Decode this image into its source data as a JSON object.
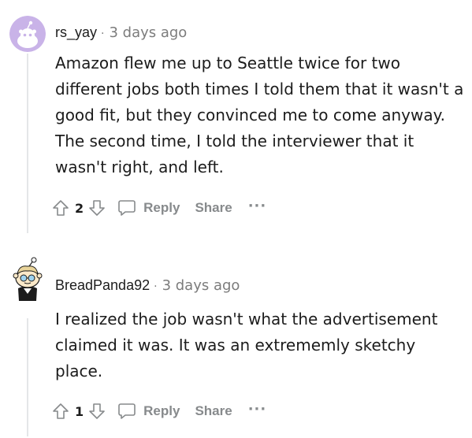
{
  "comments": [
    {
      "author": "rs_yay",
      "separator": "·",
      "time": "3 days ago",
      "body": "Amazon flew me up to Seattle twice for two different jobs both times I told them that it wasn't a good fit, but they convinced me to come anyway. The second time, I told the interviewer that it wasn't right, and left.",
      "votes": "2",
      "reply_label": "Reply",
      "share_label": "Share",
      "more_label": "···"
    },
    {
      "author": "BreadPanda92",
      "separator": "·",
      "time": "3 days ago",
      "body": "I realized the job wasn't what the advertisement claimed it was. It was an extrememly sketchy place.",
      "votes": "1",
      "reply_label": "Reply",
      "share_label": "Share",
      "more_label": "···"
    }
  ],
  "colors": {
    "meta_gray": "#7c7c7c",
    "action_gray": "#878a8c",
    "thread_line": "#e4e6e8",
    "avatar_purple": "#c9b3e8"
  },
  "icons": [
    "snoo-avatar-icon",
    "upvote-icon",
    "downvote-icon",
    "comment-bubble-icon",
    "more-options-icon"
  ]
}
